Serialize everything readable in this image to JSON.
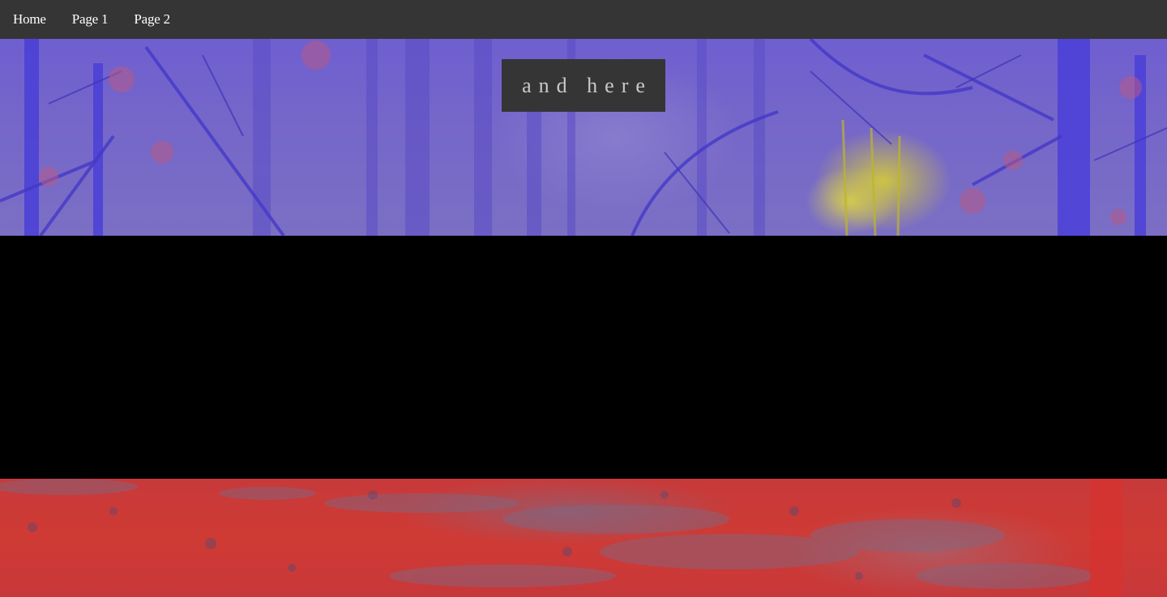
{
  "nav": {
    "items": [
      {
        "label": "Home"
      },
      {
        "label": "Page 1"
      },
      {
        "label": "Page 2"
      }
    ]
  },
  "hero": {
    "caption": "and here"
  },
  "colors": {
    "nav_bg": "#353535",
    "caption_bg": "#353535",
    "caption_text": "#c9c9c9",
    "section1_tint": "#6f5fd0",
    "section2_tint": "#c73a3a",
    "band": "#000000"
  }
}
